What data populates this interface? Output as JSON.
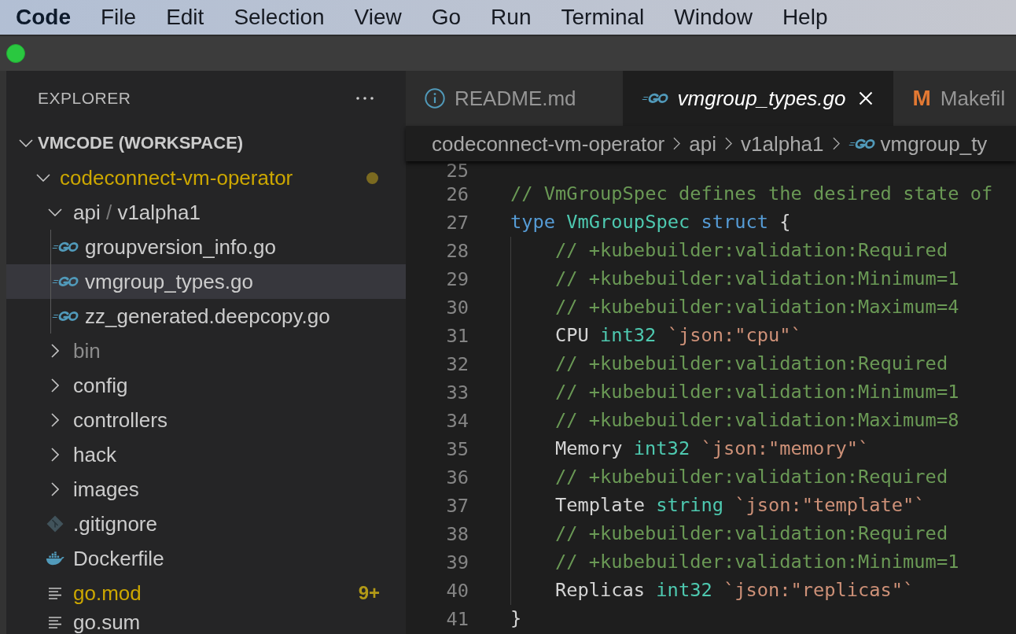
{
  "menu_bar": {
    "items": [
      {
        "label": "Code",
        "kind": "app"
      },
      {
        "label": "File",
        "kind": "menu"
      },
      {
        "label": "Edit",
        "kind": "menu"
      },
      {
        "label": "Selection",
        "kind": "menu"
      },
      {
        "label": "View",
        "kind": "menu"
      },
      {
        "label": "Go",
        "kind": "menu"
      },
      {
        "label": "Run",
        "kind": "menu"
      },
      {
        "label": "Terminal",
        "kind": "menu"
      },
      {
        "label": "Window",
        "kind": "menu"
      },
      {
        "label": "Help",
        "kind": "menu"
      }
    ]
  },
  "explorer": {
    "title": "EXPLORER",
    "tree": [
      {
        "kind": "workspace",
        "label": "VMCODE (WORKSPACE)",
        "expanded": true,
        "selected": false,
        "children": [
          {
            "kind": "folder",
            "label": "codeconnect-vm-operator",
            "expanded": true,
            "selected": false,
            "warning": true,
            "dot": true,
            "children": [
              {
                "kind": "folder",
                "label_parts": [
                  "api",
                  "v1alpha1"
                ],
                "separator": "/",
                "expanded": true,
                "selected": false,
                "children": [
                  {
                    "kind": "go-file",
                    "label": "groupversion_info.go",
                    "selected": false
                  },
                  {
                    "kind": "go-file",
                    "label": "vmgroup_types.go",
                    "selected": true
                  },
                  {
                    "kind": "go-file",
                    "label": "zz_generated.deepcopy.go",
                    "selected": false
                  }
                ]
              },
              {
                "kind": "folder",
                "label": "bin",
                "expanded": false,
                "selected": false,
                "ignored": true
              },
              {
                "kind": "folder",
                "label": "config",
                "expanded": false,
                "selected": false
              },
              {
                "kind": "folder",
                "label": "controllers",
                "expanded": false,
                "selected": false
              },
              {
                "kind": "folder",
                "label": "hack",
                "expanded": false,
                "selected": false
              },
              {
                "kind": "folder",
                "label": "images",
                "expanded": false,
                "selected": false
              },
              {
                "kind": "git-file",
                "label": ".gitignore",
                "selected": false
              },
              {
                "kind": "docker-file",
                "label": "Dockerfile",
                "selected": false
              },
              {
                "kind": "text-file",
                "label": "go.mod",
                "selected": false,
                "warning": true,
                "badge": "9+"
              },
              {
                "kind": "text-file",
                "label": "go.sum",
                "selected": false
              }
            ]
          }
        ]
      }
    ]
  },
  "editor": {
    "tabs": [
      {
        "kind": "info",
        "label": "README.md",
        "selected": false,
        "preview": false
      },
      {
        "kind": "go",
        "label": "vmgroup_types.go",
        "selected": true,
        "preview": true
      },
      {
        "kind": "makefile",
        "icon_text": "M",
        "label": "Makefil",
        "selected": false,
        "preview": false
      }
    ],
    "breadcrumb": [
      {
        "kind": "folder",
        "label": "codeconnect-vm-operator"
      },
      {
        "kind": "folder",
        "label": "api"
      },
      {
        "kind": "folder",
        "label": "v1alpha1"
      },
      {
        "kind": "go-file",
        "label": "vmgroup_ty"
      }
    ],
    "lines": [
      {
        "number": "25"
      },
      {
        "number": "26",
        "tokens": [
          {
            "kind": "comment",
            "text": "// VmGroupSpec defines the desired state of"
          }
        ]
      },
      {
        "number": "27",
        "tokens": [
          {
            "kind": "keyword",
            "text": "type"
          },
          {
            "kind": "type",
            "text": " VmGroupSpec"
          },
          {
            "kind": "keyword",
            "text": " struct"
          },
          {
            "kind": "plain",
            "text": " {"
          }
        ]
      },
      {
        "number": "28",
        "indented": true,
        "tokens": [
          {
            "kind": "comment",
            "text": "// +kubebuilder:validation:Required"
          }
        ]
      },
      {
        "number": "29",
        "indented": true,
        "tokens": [
          {
            "kind": "comment",
            "text": "// +kubebuilder:validation:Minimum=1"
          }
        ]
      },
      {
        "number": "30",
        "indented": true,
        "tokens": [
          {
            "kind": "comment",
            "text": "// +kubebuilder:validation:Maximum=4"
          }
        ]
      },
      {
        "number": "31",
        "indented": true,
        "tokens": [
          {
            "kind": "plain",
            "text": "CPU"
          },
          {
            "kind": "type",
            "text": " int32"
          },
          {
            "kind": "string",
            "text": " `json:\"cpu\"`"
          }
        ]
      },
      {
        "number": "32",
        "indented": true,
        "tokens": [
          {
            "kind": "comment",
            "text": "// +kubebuilder:validation:Required"
          }
        ]
      },
      {
        "number": "33",
        "indented": true,
        "tokens": [
          {
            "kind": "comment",
            "text": "// +kubebuilder:validation:Minimum=1"
          }
        ]
      },
      {
        "number": "34",
        "indented": true,
        "tokens": [
          {
            "kind": "comment",
            "text": "// +kubebuilder:validation:Maximum=8"
          }
        ]
      },
      {
        "number": "35",
        "indented": true,
        "tokens": [
          {
            "kind": "plain",
            "text": "Memory"
          },
          {
            "kind": "type",
            "text": " int32"
          },
          {
            "kind": "string",
            "text": " `json:\"memory\"`"
          }
        ]
      },
      {
        "number": "36",
        "indented": true,
        "tokens": [
          {
            "kind": "comment",
            "text": "// +kubebuilder:validation:Required"
          }
        ]
      },
      {
        "number": "37",
        "indented": true,
        "tokens": [
          {
            "kind": "plain",
            "text": "Template"
          },
          {
            "kind": "type",
            "text": " string"
          },
          {
            "kind": "string",
            "text": " `json:\"template\"`"
          }
        ]
      },
      {
        "number": "38",
        "indented": true,
        "tokens": [
          {
            "kind": "comment",
            "text": "// +kubebuilder:validation:Required"
          }
        ]
      },
      {
        "number": "39",
        "indented": true,
        "tokens": [
          {
            "kind": "comment",
            "text": "// +kubebuilder:validation:Minimum=1"
          }
        ]
      },
      {
        "number": "40",
        "indented": true,
        "tokens": [
          {
            "kind": "plain",
            "text": "Replicas"
          },
          {
            "kind": "type",
            "text": " int32"
          },
          {
            "kind": "string",
            "text": " `json:\"replicas\"`"
          }
        ]
      },
      {
        "number": "41",
        "tokens": [
          {
            "kind": "plain",
            "text": "}"
          }
        ]
      }
    ]
  }
}
